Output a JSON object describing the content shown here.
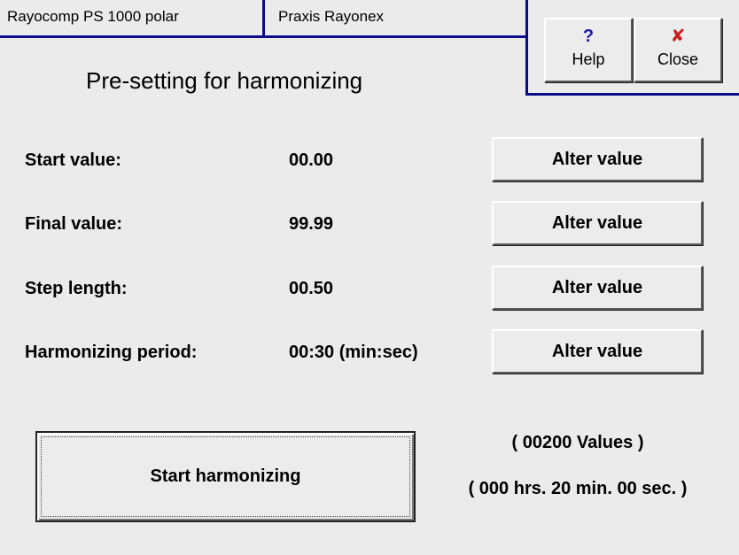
{
  "header": {
    "device_label": "Rayocomp PS 1000 polar",
    "practice_label": "Praxis Rayonex"
  },
  "title": "Pre-setting for harmonizing",
  "toolbar": {
    "help": {
      "icon": "?",
      "label": "Help",
      "icon_color": "#1a1aa8"
    },
    "close": {
      "icon": "✘",
      "label": "Close",
      "icon_color": "#c81e1e"
    }
  },
  "settings": [
    {
      "label": "Start value:",
      "value": "00.00",
      "button": "Alter value"
    },
    {
      "label": "Final value:",
      "value": "99.99",
      "button": "Alter value"
    },
    {
      "label": "Step length:",
      "value": "00.50",
      "button": "Alter value"
    },
    {
      "label": "Harmonizing period:",
      "value": "00:30 (min:sec)",
      "button": "Alter value"
    }
  ],
  "start_button": "Start harmonizing",
  "summary": {
    "values": "( 00200 Values )",
    "duration": "( 000 hrs. 20 min. 00 sec.  )"
  },
  "colors": {
    "accent_blue": "#0a0a8c",
    "background": "#ebebeb"
  }
}
